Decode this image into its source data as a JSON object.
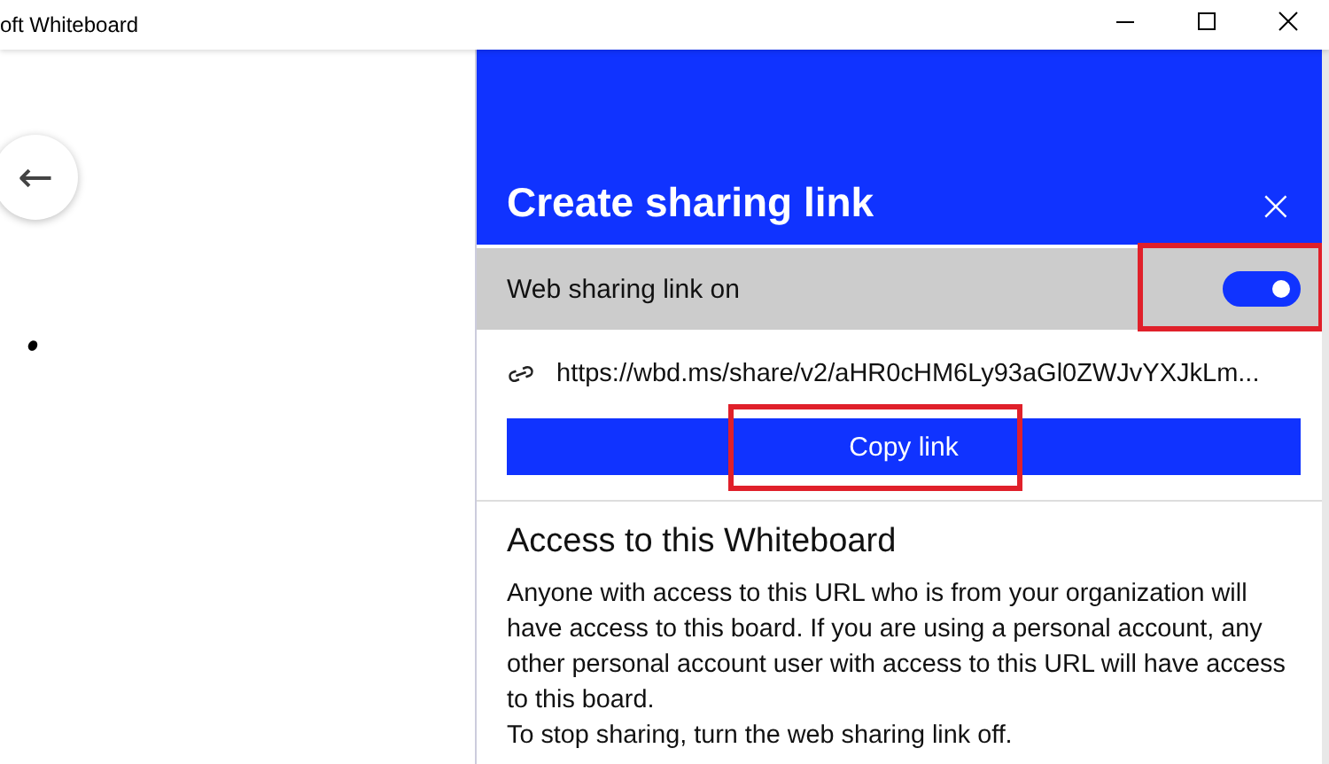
{
  "window": {
    "title": "oft Whiteboard"
  },
  "canvas": {
    "back_button": "←",
    "marks": [
      {
        "kind": "dot"
      }
    ]
  },
  "share_panel": {
    "title": "Create sharing link",
    "close": "×",
    "toggle": {
      "label": "Web sharing link on",
      "on": true,
      "highlighted": true
    },
    "link": "https://wbd.ms/share/v2/aHR0cHM6Ly93aGl0ZWJvYXJkLm...",
    "copy_button": {
      "label": "Copy link",
      "highlighted": true
    },
    "access": {
      "heading": "Access to this Whiteboard",
      "paragraphs": [
        "Anyone with access to this URL who is from your organization will have access to this board. If you are using a personal account, any other personal account user with access to this URL will have access to this board.",
        "To stop sharing, turn the web sharing link off."
      ]
    }
  }
}
